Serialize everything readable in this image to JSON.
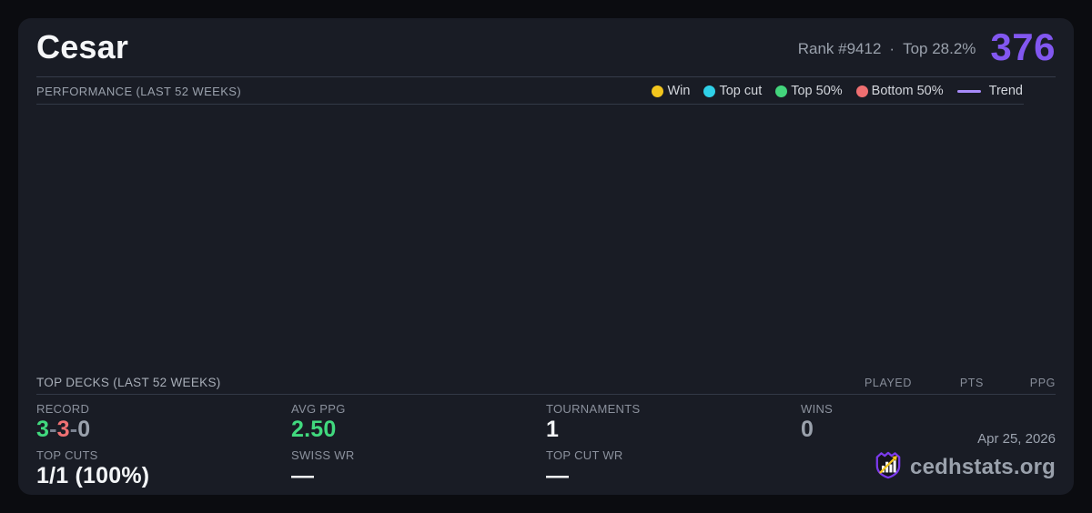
{
  "header": {
    "title": "Cesar",
    "rank_text": "Rank #9412",
    "separator": "·",
    "top_percent_text": "Top 28.2%",
    "score": "376",
    "score_color": "#8257f0"
  },
  "performance": {
    "header": "PERFORMANCE (LAST 52 WEEKS)",
    "legend": {
      "win": {
        "label": "Win",
        "color": "#f2c51d"
      },
      "top_cut": {
        "label": "Top cut",
        "color": "#2fd0e8"
      },
      "top_50": {
        "label": "Top 50%",
        "color": "#43d57c"
      },
      "bottom_50": {
        "label": "Bottom 50%",
        "color": "#ef6f71"
      },
      "trend": {
        "label": "Trend",
        "color": "#a78bfa"
      }
    }
  },
  "top_decks": {
    "header": "TOP DECKS (LAST 52 WEEKS)",
    "columns": [
      "PLAYED",
      "PTS",
      "PPG"
    ],
    "rows": []
  },
  "stats": {
    "record": {
      "label": "RECORD",
      "wins": "3",
      "losses": "3",
      "draws": "0",
      "separator": "-",
      "wins_color": "#41d97e",
      "losses_color": "#f07173"
    },
    "avg_ppg": {
      "label": "AVG PPG",
      "value": "2.50",
      "color": "#41d97e"
    },
    "tournaments": {
      "label": "TOURNAMENTS",
      "value": "1"
    },
    "wins": {
      "label": "WINS",
      "value": "0"
    },
    "top_cuts": {
      "label": "TOP CUTS",
      "value": "1/1 (100%)"
    },
    "swiss_wr": {
      "label": "SWISS WR",
      "value": "—"
    },
    "top_cut_wr": {
      "label": "TOP CUT WR",
      "value": "—"
    }
  },
  "footer": {
    "date": "Apr 25, 2026",
    "site": "cedhstats.org"
  }
}
